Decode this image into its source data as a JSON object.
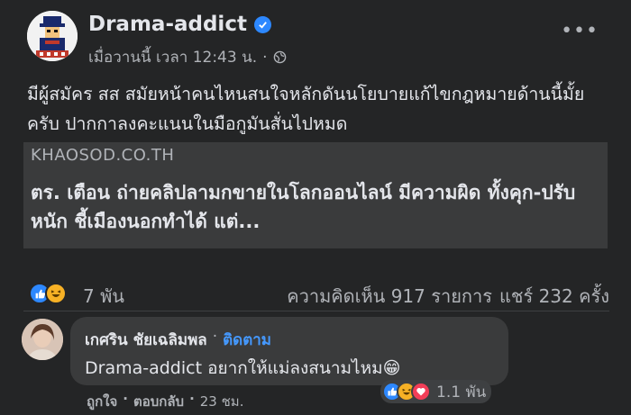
{
  "post": {
    "page_name": "Drama-addict",
    "timestamp": "เมื่อวานนี้ เวลา 12:43 น.",
    "separator": "·",
    "more_label": "•••",
    "text": "มีผู้สมัคร สส สมัยหน้าคนไหนสนใจหลักดันนโยบายแก้ไขกฎหมายด้านนี้มั้ยครับ ปากกาลงคะแนนในมือกูมันสั่นไปหมด"
  },
  "link_card": {
    "domain": "KHAOSOD.CO.TH",
    "title": "ตร. เตือน ถ่ายคลิปลามกขายในโลกออนไลน์ มีความผิด ทั้งคุก-ปรับหนัก ชี้เมืองนอกทำได้ แต่..."
  },
  "stats": {
    "reactions_count": "7 พัน",
    "comments": "ความคิดเห็น 917 รายการ",
    "shares": "แชร์ 232 ครั้ง"
  },
  "comment": {
    "author": "เกศริน ชัยเฉลิมพล",
    "dot": "·",
    "follow_label": "ติดตาม",
    "text": "Drama-addict อยากให้แม่ลงสนามไหม😁",
    "reactions_count": "1.1 พัน",
    "like_label": "ถูกใจ",
    "reply_label": "ตอบกลับ",
    "time": "23 ชม.",
    "sep": "·"
  },
  "colors": {
    "background": "#242526",
    "card": "#3a3b3c",
    "text_primary": "#e4e6eb",
    "text_secondary": "#b0b3b8",
    "accent_blue": "#2d88ff"
  },
  "icons": [
    "page-avatar-logo",
    "verified-badge-icon",
    "globe-icon",
    "more-options-icon",
    "like-reaction-icon",
    "haha-reaction-icon",
    "love-reaction-icon"
  ]
}
